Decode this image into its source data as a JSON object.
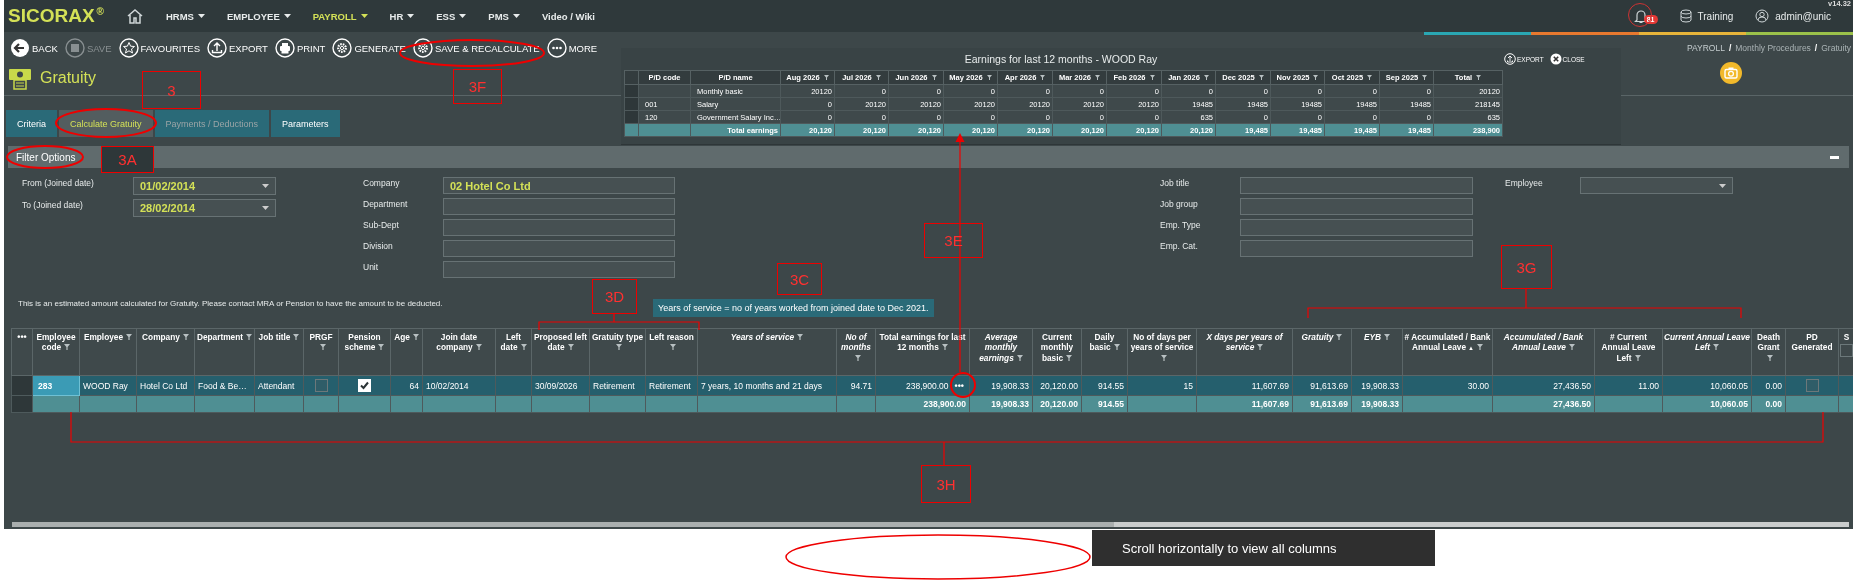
{
  "app": {
    "logo": "SICORAX",
    "logo_mark": "®",
    "version": "v14.32"
  },
  "nav": [
    {
      "label": "HRMS",
      "dropdown": true,
      "selected": false
    },
    {
      "label": "EMPLOYEE",
      "dropdown": true,
      "selected": false
    },
    {
      "label": "PAYROLL",
      "dropdown": true,
      "selected": true
    },
    {
      "label": "HR",
      "dropdown": true,
      "selected": false
    },
    {
      "label": "ESS",
      "dropdown": true,
      "selected": false
    },
    {
      "label": "PMS",
      "dropdown": true,
      "selected": false
    },
    {
      "label": "Video / Wiki",
      "dropdown": false,
      "selected": false
    }
  ],
  "header_right": {
    "notification_count": "81",
    "database": "Training",
    "user": "admin@unic"
  },
  "toolbar": [
    {
      "label": "BACK",
      "kind": "back",
      "disabled": false
    },
    {
      "label": "SAVE",
      "kind": "save",
      "disabled": true
    },
    {
      "label": "FAVOURITES",
      "kind": "favourite",
      "disabled": false
    },
    {
      "label": "EXPORT",
      "kind": "export",
      "disabled": false
    },
    {
      "label": "PRINT",
      "kind": "print",
      "disabled": false
    },
    {
      "label": "GENERATE",
      "kind": "generate",
      "disabled": false
    },
    {
      "label": "SAVE & RECALCULATE",
      "kind": "recalculate",
      "disabled": false
    },
    {
      "label": "MORE",
      "kind": "more",
      "disabled": false
    }
  ],
  "breadcrumb": {
    "items": [
      "PAYROLL",
      "Monthly Procedures",
      "Gratuity"
    ],
    "separator": "/"
  },
  "page_title": "Gratuity",
  "tabs": [
    {
      "label": "Criteria",
      "selected": false,
      "disabled": false
    },
    {
      "label": "Calculate Gratuity",
      "selected": true,
      "disabled": false
    },
    {
      "label": "Payments / Deductions",
      "selected": false,
      "disabled": true
    },
    {
      "label": "Parameters",
      "selected": false,
      "disabled": false
    }
  ],
  "filter": {
    "title": "Filter Options",
    "groups": [
      [
        {
          "label": "From (Joined date)",
          "kind": "dropdown",
          "value": "01/02/2014"
        },
        {
          "label": "To (Joined date)",
          "kind": "dropdown",
          "value": "28/02/2014"
        }
      ],
      [
        {
          "label": "Company",
          "kind": "text",
          "value": "02 Hotel Co Ltd"
        },
        {
          "label": "Department",
          "kind": "text"
        },
        {
          "label": "Sub-Dept",
          "kind": "text"
        },
        {
          "label": "Division",
          "kind": "text"
        },
        {
          "label": "Unit",
          "kind": "text"
        }
      ],
      [
        {
          "label": "Job title",
          "kind": "text"
        },
        {
          "label": "Job group",
          "kind": "text"
        },
        {
          "label": "Emp. Type",
          "kind": "text"
        },
        {
          "label": "Emp. Cat.",
          "kind": "text"
        }
      ],
      [
        {
          "label": "Employee",
          "kind": "dropdown"
        }
      ]
    ]
  },
  "note": "This is an estimated amount calculated for Gratuity. Please contact MRA or Pension to have the amount to be deducted.",
  "tooltip": "Years of service = no of years worked from joined date to Dec 2021.",
  "earnings_popup": {
    "title": "Earnings for last 12 months - WOOD Ray",
    "actions": [
      {
        "label": "EXPORT",
        "kind": "export"
      },
      {
        "label": "CLOSE",
        "kind": "close"
      }
    ],
    "columns": [
      {
        "label": "P/D code",
        "filter": false
      },
      {
        "label": "P/D name",
        "filter": false
      },
      {
        "label": "Aug 2026",
        "filter": true
      },
      {
        "label": "Jul 2026",
        "filter": true
      },
      {
        "label": "Jun 2026",
        "filter": true
      },
      {
        "label": "May 2026",
        "filter": true
      },
      {
        "label": "Apr 2026",
        "filter": true
      },
      {
        "label": "Mar 2026",
        "filter": true
      },
      {
        "label": "Feb 2026",
        "filter": true
      },
      {
        "label": "Jan 2026",
        "filter": true
      },
      {
        "label": "Dec 2025",
        "filter": true
      },
      {
        "label": "Nov 2025",
        "filter": true
      },
      {
        "label": "Oct 2025",
        "filter": true
      },
      {
        "label": "Sep 2025",
        "filter": true
      },
      {
        "label": "Total",
        "filter": true
      }
    ],
    "rows": [
      {
        "kind": "data",
        "cells": [
          null,
          "Monthly basic",
          "20120",
          "0",
          "0",
          "0",
          "0",
          "0",
          "0",
          "0",
          "0",
          "0",
          "0",
          "0",
          "20120"
        ]
      },
      {
        "kind": "data",
        "cells": [
          "001",
          "Salary",
          "0",
          "20120",
          "20120",
          "20120",
          "20120",
          "20120",
          "20120",
          "19485",
          "19485",
          "19485",
          "19485",
          "19485",
          "218145"
        ]
      },
      {
        "kind": "data",
        "cells": [
          "120",
          "Government Salary Inc…",
          "0",
          "0",
          "0",
          "0",
          "0",
          "0",
          "0",
          "635",
          "0",
          "0",
          "0",
          "0",
          "635"
        ]
      },
      {
        "kind": "total",
        "cells": [
          null,
          "Total earnings",
          "20,120",
          "20,120",
          "20,120",
          "20,120",
          "20,120",
          "20,120",
          "20,120",
          "20,120",
          "19,485",
          "19,485",
          "19,485",
          "19,485",
          "238,900"
        ]
      }
    ]
  },
  "grid": {
    "more_label": "•••",
    "columns": [
      {
        "label": "Employee code",
        "kind": "text",
        "italic": false,
        "filter": true
      },
      {
        "label": "Employee",
        "kind": "text",
        "italic": false,
        "filter": true
      },
      {
        "label": "Company",
        "kind": "text",
        "italic": false,
        "filter": true
      },
      {
        "label": "Department",
        "kind": "text",
        "italic": false,
        "filter": true
      },
      {
        "label": "Job title",
        "kind": "text",
        "italic": false,
        "filter": true
      },
      {
        "label": "PRGF",
        "kind": "check",
        "italic": false,
        "filter": true
      },
      {
        "label": "Pension scheme",
        "kind": "check",
        "italic": false,
        "filter": true
      },
      {
        "label": "Age",
        "kind": "number",
        "italic": false,
        "filter": true
      },
      {
        "label": "Join date company",
        "kind": "text",
        "italic": false,
        "filter": true
      },
      {
        "label": "Left date",
        "kind": "text",
        "italic": false,
        "filter": true
      },
      {
        "label": "Proposed left date",
        "kind": "text",
        "italic": false,
        "filter": true
      },
      {
        "label": "Gratuity type",
        "kind": "text",
        "italic": false,
        "filter": true
      },
      {
        "label": "Left reason",
        "kind": "text",
        "italic": false,
        "filter": true
      },
      {
        "label": "Years of service",
        "kind": "text",
        "italic": true,
        "filter": true
      },
      {
        "label": "No of months",
        "kind": "number",
        "italic": true,
        "filter": true
      },
      {
        "label": "Total earnings for last 12 months",
        "kind": "number",
        "italic": false,
        "filter": true
      },
      {
        "label": "Average monthly earnings",
        "kind": "number",
        "italic": true,
        "filter": true
      },
      {
        "label": "Current monthly basic",
        "kind": "number",
        "italic": false,
        "filter": true
      },
      {
        "label": "Daily basic",
        "kind": "number",
        "italic": false,
        "filter": true
      },
      {
        "label": "No of days per years of service",
        "kind": "number",
        "italic": false,
        "filter": true
      },
      {
        "label": "X days per years of service",
        "kind": "number",
        "italic": true,
        "filter": true
      },
      {
        "label": "Gratuity",
        "kind": "number",
        "italic": true,
        "filter": true
      },
      {
        "label": "EYB",
        "kind": "number",
        "italic": true,
        "filter": true
      },
      {
        "label": "# Accumulated / Bank Annual Leave",
        "kind": "number",
        "italic": false,
        "filter": true,
        "sort": "▲"
      },
      {
        "label": "Accumulated / Bank Annual Leave",
        "kind": "number",
        "italic": true,
        "filter": true
      },
      {
        "label": "# Current Annual Leave Left",
        "kind": "number",
        "italic": false,
        "filter": true
      },
      {
        "label": "Current Annual Leave Left",
        "kind": "number",
        "italic": true,
        "filter": true
      },
      {
        "label": "Death Grant",
        "kind": "number",
        "italic": false,
        "filter": true
      },
      {
        "label": "PD Generated",
        "kind": "check",
        "italic": false,
        "filter": false
      },
      {
        "label": "S",
        "kind": "select",
        "italic": false,
        "filter": false,
        "checked": false
      }
    ],
    "rows": [
      {
        "kind": "data",
        "selected": true,
        "cells": [
          {
            "text": "283",
            "active": true
          },
          "WOOD Ray",
          "Hotel Co Ltd",
          "Food & Be…",
          "Attendant",
          {
            "checked": false
          },
          {
            "checked": true
          },
          "64",
          "10/02/2014",
          null,
          "30/09/2026",
          "Retirement",
          "Retirement",
          "7 years, 10 months and 21 days",
          "94.71",
          {
            "text": "238,900.00",
            "more": "•••"
          },
          "19,908.33",
          "20,120.00",
          "914.55",
          "15",
          "11,607.69",
          "91,613.69",
          "19,908.33",
          "30.00",
          "27,436.50",
          "11.00",
          "10,060.05",
          "0.00",
          {
            "checked": false
          },
          null
        ]
      },
      {
        "kind": "total",
        "selected": false,
        "cells": [
          null,
          null,
          null,
          null,
          null,
          null,
          null,
          null,
          null,
          null,
          null,
          null,
          null,
          null,
          null,
          "238,900.00",
          "19,908.33",
          "20,120.00",
          "914.55",
          null,
          "11,607.69",
          "91,613.69",
          "19,908.33",
          null,
          "27,436.50",
          null,
          "10,060.05",
          "0.00",
          null,
          null
        ]
      }
    ]
  },
  "annotations": [
    {
      "label": "3"
    },
    {
      "label": "3F"
    },
    {
      "label": "3A"
    },
    {
      "label": "3D"
    },
    {
      "label": "3C"
    },
    {
      "label": "3E"
    },
    {
      "label": "3G"
    },
    {
      "label": "3H"
    }
  ],
  "callout": "Scroll horizontally to view all columns"
}
